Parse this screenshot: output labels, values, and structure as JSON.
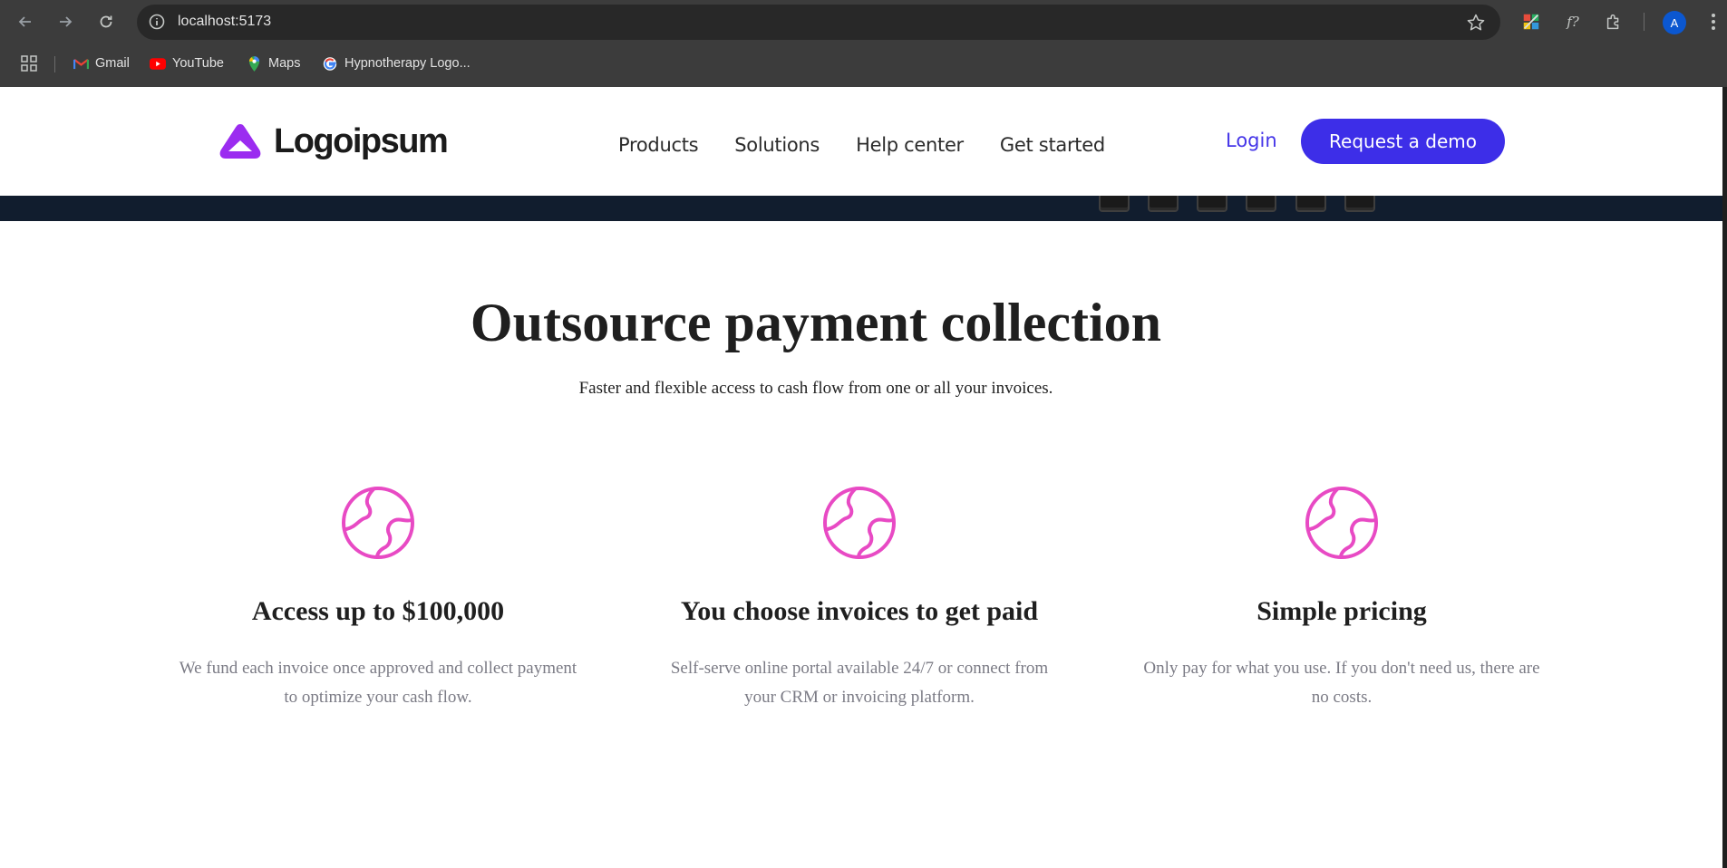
{
  "browser": {
    "url": "localhost:5173",
    "avatar_initial": "A",
    "bookmarks": [
      {
        "label": "Gmail",
        "icon": "gmail-icon"
      },
      {
        "label": "YouTube",
        "icon": "youtube-icon"
      },
      {
        "label": "Maps",
        "icon": "maps-icon"
      },
      {
        "label": "Hypnotherapy Logo...",
        "icon": "google-icon"
      }
    ]
  },
  "header": {
    "logo_text": "Logoipsum",
    "nav": [
      "Products",
      "Solutions",
      "Help center",
      "Get started"
    ],
    "login_label": "Login",
    "demo_label": "Request a demo"
  },
  "section": {
    "title": "Outsource payment collection",
    "subtitle": "Faster and flexible access to cash flow from one or all your invoices."
  },
  "features": [
    {
      "icon": "globe-icon",
      "title": "Access up to $100,000",
      "text": "We fund each invoice once approved and collect payment to optimize your cash flow."
    },
    {
      "icon": "globe-icon",
      "title": "You choose invoices to get paid",
      "text": "Self-serve online portal available 24/7 or connect from your CRM or invoicing platform."
    },
    {
      "icon": "globe-icon",
      "title": "Simple pricing",
      "text": "Only pay for what you use. If you don't need us, there are no costs."
    }
  ],
  "colors": {
    "brand_purple": "#9b2cf0",
    "accent_blue": "#3d2ee8",
    "icon_pink": "#e84ac4",
    "strip_dark": "#111d2e"
  }
}
